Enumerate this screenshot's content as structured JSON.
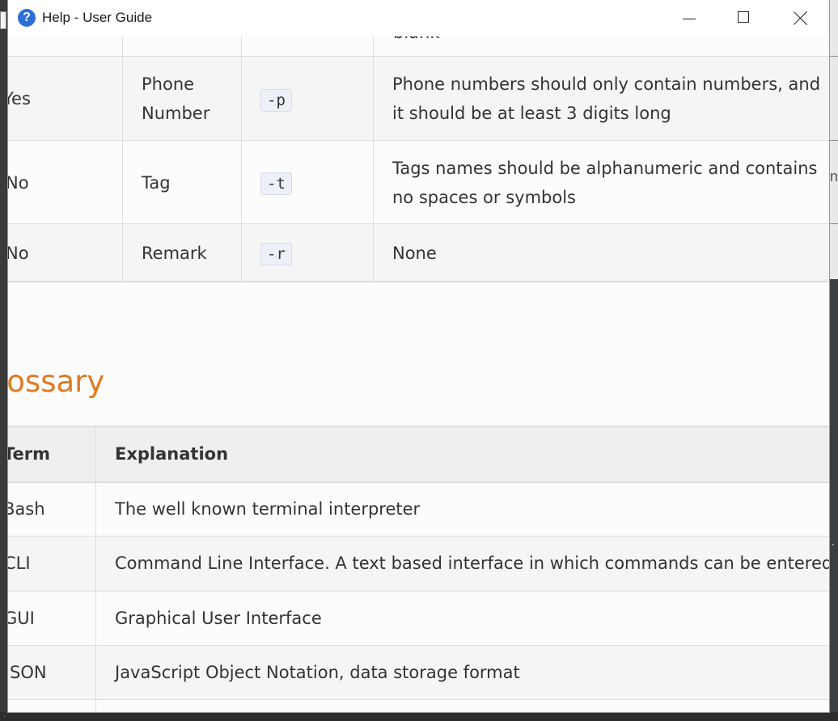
{
  "window": {
    "title": "Help - User Guide",
    "app_icon": "?"
  },
  "fields_table": {
    "rows": [
      {
        "optional": "Yes",
        "field": [
          "Phone",
          "Number"
        ],
        "prefix": "-p",
        "constraint": [
          "Phone numbers should only contain numbers, and",
          "it should be at least 3 digits long"
        ]
      },
      {
        "optional": "No",
        "field": [
          "Tag"
        ],
        "prefix": "-t",
        "constraint": [
          "Tags names should be alphanumeric and contains",
          "no spaces or symbols"
        ]
      },
      {
        "optional": "No",
        "field": [
          "Remark"
        ],
        "prefix": "-r",
        "constraint": [
          "None"
        ]
      }
    ],
    "partial_top_text": "blank"
  },
  "glossary": {
    "heading": "lossary",
    "headers": {
      "term": "Term",
      "explanation": "Explanation"
    },
    "rows": [
      {
        "term": "Bash",
        "explanation": "The well known terminal interpreter"
      },
      {
        "term": "CLI",
        "explanation": "Command Line Interface. A text based interface in which commands can be entered"
      },
      {
        "term": "GUI",
        "explanation": "Graphical User Interface"
      },
      {
        "term": "SON",
        "explanation": "JavaScript Object Notation, data storage format"
      }
    ]
  },
  "colors": {
    "heading": "#e07a22",
    "text": "#333333",
    "header_bg": "#efefef",
    "stripe_bg": "#f5f5f5",
    "code_bg": "#eef0f7"
  },
  "icons": [
    "help-icon",
    "minimize-icon",
    "maximize-icon",
    "close-icon"
  ]
}
